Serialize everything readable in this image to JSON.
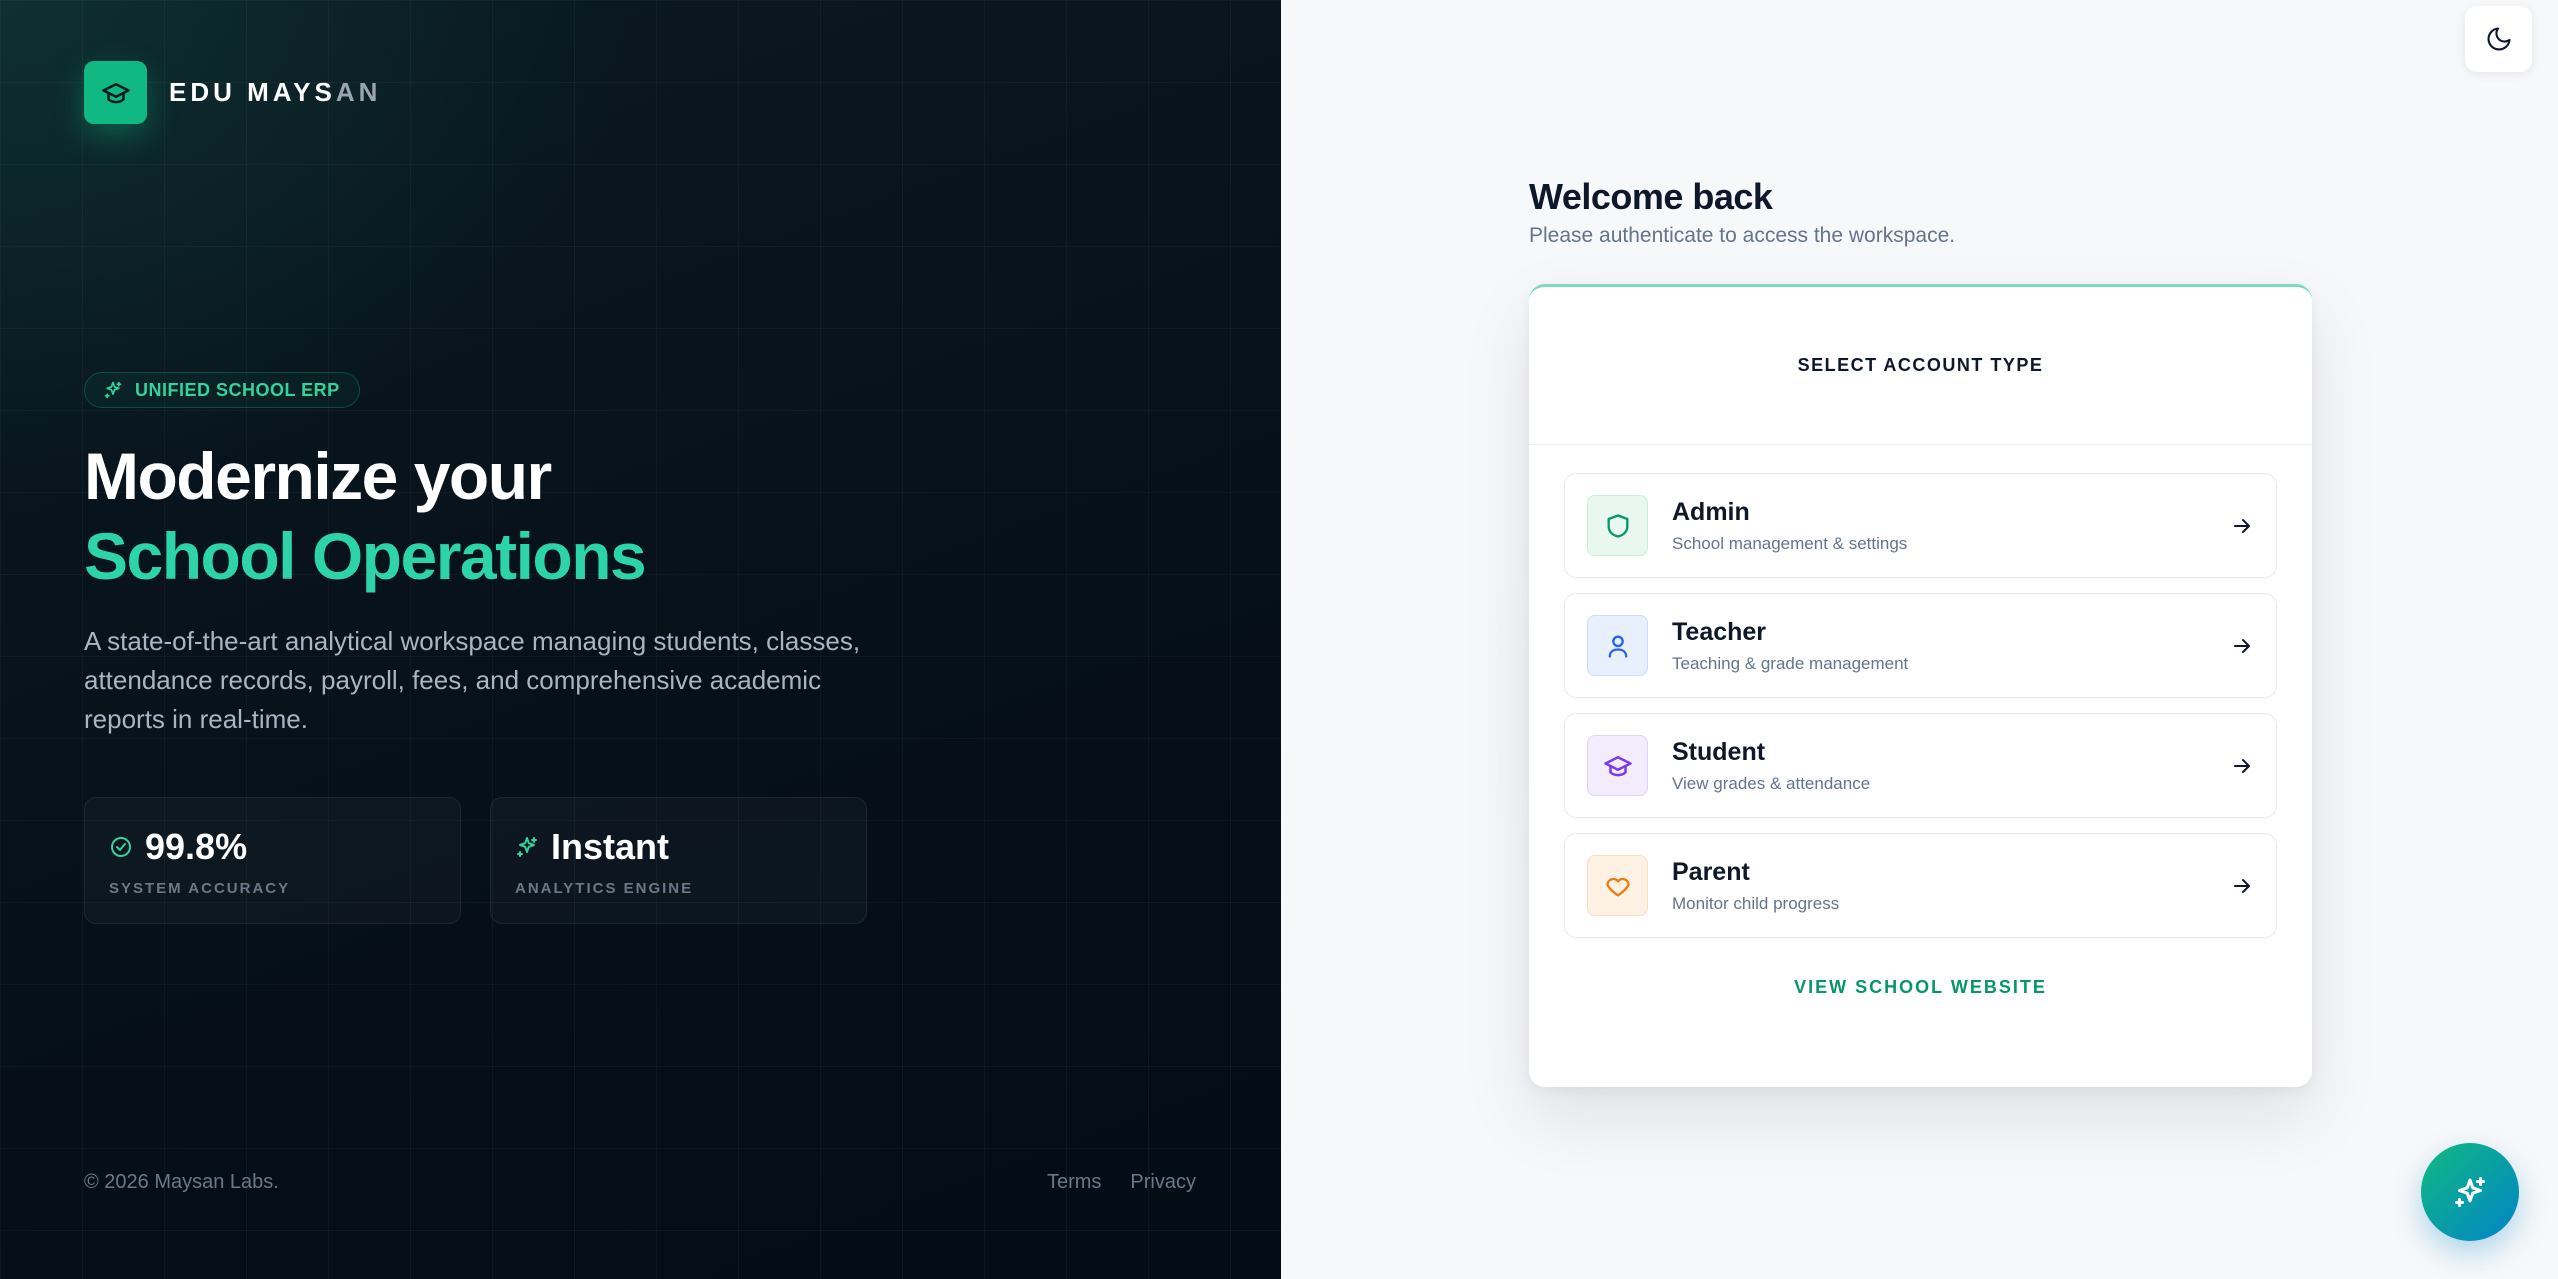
{
  "brand": {
    "name_strong": "EDU MAYS",
    "name_dim": "AN"
  },
  "hero": {
    "badge": "UNIFIED SCHOOL ERP",
    "headline_line1": "Modernize your",
    "headline_line2": "School Operations",
    "description": "A state-of-the-art analytical workspace managing students, classes, attendance records, payroll, fees, and comprehensive academic reports in real-time."
  },
  "stats": [
    {
      "value": "99.8%",
      "label": "SYSTEM ACCURACY",
      "icon": "check-circle-icon"
    },
    {
      "value": "Instant",
      "label": "ANALYTICS ENGINE",
      "icon": "sparkles-icon"
    }
  ],
  "footer": {
    "copyright": "© 2026 Maysan Labs.",
    "terms": "Terms",
    "privacy": "Privacy"
  },
  "login": {
    "title": "Welcome back",
    "subtitle": "Please authenticate to access the workspace.",
    "card_heading": "SELECT ACCOUNT TYPE",
    "roles": [
      {
        "title": "Admin",
        "desc": "School management & settings",
        "icon": "shield-icon",
        "color": "#059669",
        "bg": "#e8f8f1"
      },
      {
        "title": "Teacher",
        "desc": "Teaching & grade management",
        "icon": "user-icon",
        "color": "#2563eb",
        "bg": "#e8f0fd"
      },
      {
        "title": "Student",
        "desc": "View grades & attendance",
        "icon": "graduation-cap-icon",
        "color": "#7c3aed",
        "bg": "#f3ecfd"
      },
      {
        "title": "Parent",
        "desc": "Monitor child progress",
        "icon": "heart-icon",
        "color": "#ea7b0c",
        "bg": "#fdf1e3"
      }
    ],
    "view_site": "VIEW SCHOOL WEBSITE"
  },
  "colors": {
    "accent": "#10b981",
    "dark_bg": "#061019",
    "link": "#059669"
  }
}
